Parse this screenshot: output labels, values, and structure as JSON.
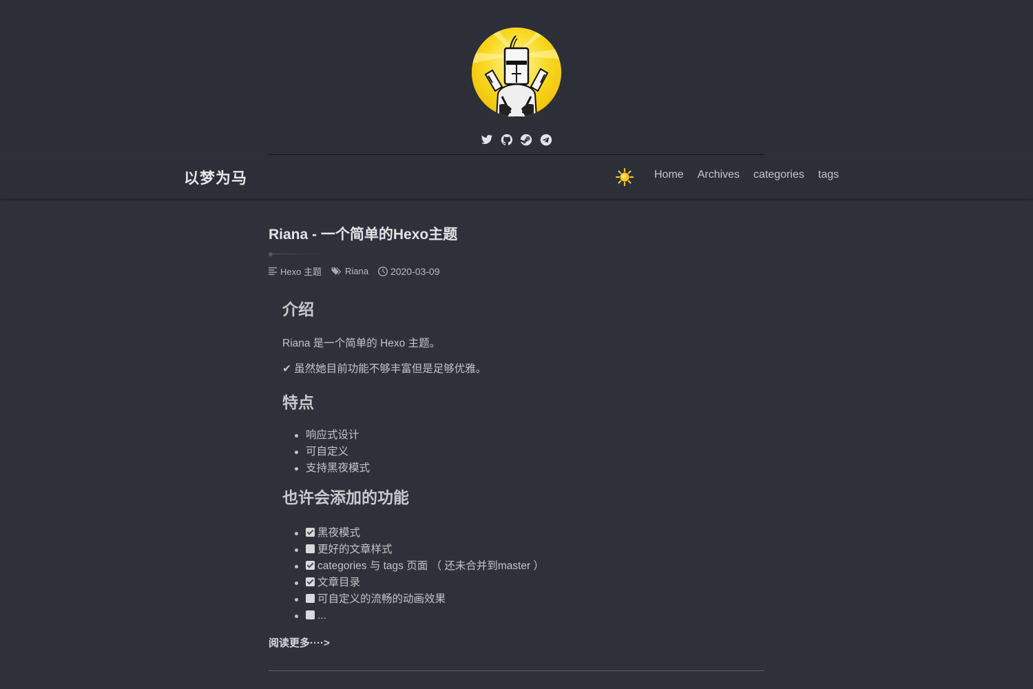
{
  "site": {
    "brand": "以梦为马"
  },
  "social": [
    {
      "icon": "twitter-icon"
    },
    {
      "icon": "github-icon"
    },
    {
      "icon": "steam-icon"
    },
    {
      "icon": "telegram-icon"
    }
  ],
  "nav": {
    "theme_icon": "sun-icon",
    "links": [
      "Home",
      "Archives",
      "categories",
      "tags"
    ]
  },
  "post": {
    "title": "Riana - 一个简单的Hexo主题",
    "category": "Hexo 主题",
    "tag": "Riana",
    "date": "2020-03-09",
    "sections": {
      "intro_heading": "介绍",
      "intro_p1": "Riana 是一个简单的 Hexo 主题。",
      "intro_p2": "✔ 虽然她目前功能不够丰富但是足够优雅。",
      "features_heading": "特点",
      "features": [
        "响应式设计",
        "可自定义",
        "支持黑夜模式"
      ],
      "todo_heading": "也许会添加的功能",
      "todo": [
        {
          "label": "黑夜模式",
          "checked": true
        },
        {
          "label": "更好的文章样式",
          "checked": false
        },
        {
          "label": "categories 与 tags 页面 （ 还未合并到master ）",
          "checked": true
        },
        {
          "label": "文章目录",
          "checked": true
        },
        {
          "label": "可自定义的流畅的动画效果",
          "checked": false
        },
        {
          "label": "...",
          "checked": false
        }
      ]
    },
    "read_more": "阅读更多····>"
  },
  "colors": {
    "background": "#2f313a",
    "header": "#2d2f38",
    "avatar_bg": "#f6d21a",
    "sun": "#f6c22a"
  }
}
